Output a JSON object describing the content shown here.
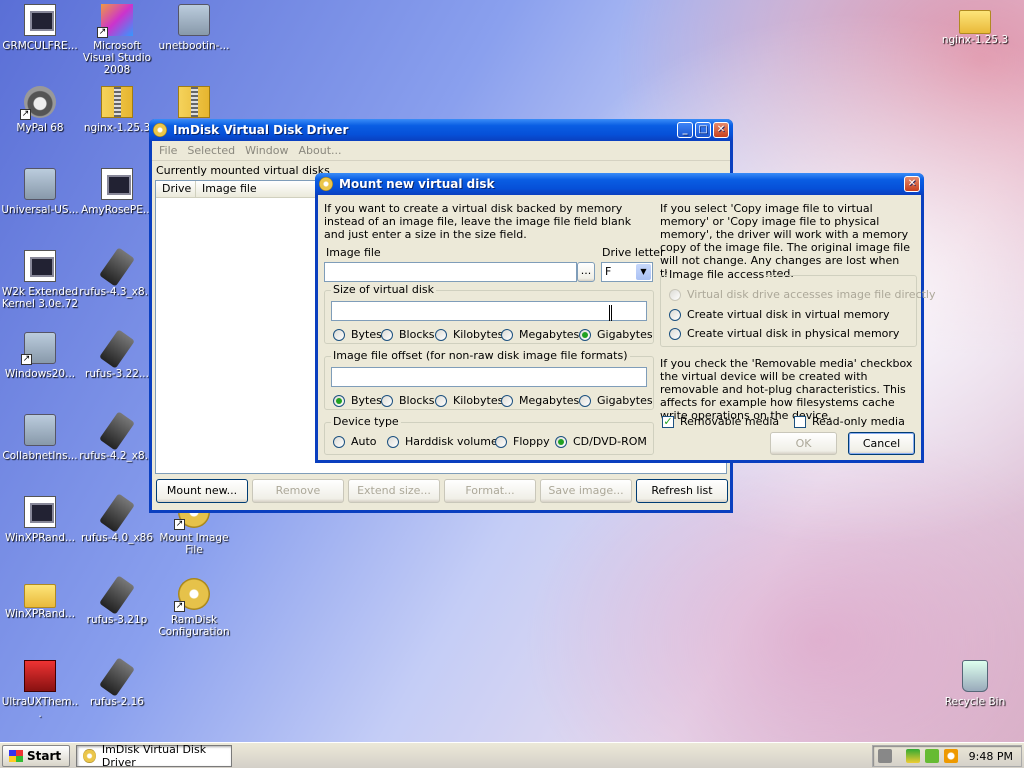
{
  "desktop": {
    "icons": [
      {
        "label": "GRMCULFRE..."
      },
      {
        "label": "Microsoft Visual Studio 2008"
      },
      {
        "label": "unetbootin-..."
      },
      {
        "label": "MyPal 68"
      },
      {
        "label": "nginx-1.25.3"
      },
      {
        "label": "nginx-1.25.3"
      },
      {
        "label": "Universal-US..."
      },
      {
        "label": "AmyRosePE..."
      },
      {
        "label": "W2k Extended Kernel 3.0e.72"
      },
      {
        "label": "rufus-4.3_x8..."
      },
      {
        "label": "Windows20..."
      },
      {
        "label": "rufus-3.22..."
      },
      {
        "label": "CollabnetIns..."
      },
      {
        "label": "rufus-4.2_x8..."
      },
      {
        "label": "WinXPRand..."
      },
      {
        "label": "rufus-4.0_x86"
      },
      {
        "label": "Mount Image File"
      },
      {
        "label": "WinXPRand..."
      },
      {
        "label": "rufus-3.21p"
      },
      {
        "label": "RamDisk Configuration"
      },
      {
        "label": "UltraUXThem..."
      },
      {
        "label": "rufus-2.16"
      },
      {
        "label": "Recycle Bin"
      }
    ]
  },
  "imdisk": {
    "title": "ImDisk Virtual Disk Driver",
    "menu": [
      "File",
      "Selected",
      "Window",
      "About..."
    ],
    "list_title": "Currently mounted virtual disks",
    "columns": [
      "Drive",
      "Image file"
    ],
    "buttons": {
      "mount": "Mount new...",
      "remove": "Remove",
      "extend": "Extend size...",
      "format": "Format...",
      "save": "Save image...",
      "refresh": "Refresh list"
    }
  },
  "dialog": {
    "title": "Mount new virtual disk",
    "intro": "If you want to create a virtual disk backed by memory instead of an image file, leave the image file field blank and just enter a size in the size field.",
    "image_file_label": "Image file",
    "image_file_value": "",
    "browse_label": "...",
    "drive_letter_label": "Drive letter",
    "drive_letter_value": "F",
    "size_group": "Size of virtual disk",
    "size_value": "",
    "size_units": [
      "Bytes",
      "Blocks",
      "Kilobytes",
      "Megabytes",
      "Gigabytes"
    ],
    "size_unit_selected": "Gigabytes",
    "offset_group": "Image file offset (for non-raw disk image file formats)",
    "offset_value": "",
    "offset_units": [
      "Bytes",
      "Blocks",
      "Kilobytes",
      "Megabytes",
      "Gigabytes"
    ],
    "offset_unit_selected": "Bytes",
    "device_group": "Device type",
    "device_types": [
      "Auto",
      "Harddisk volume",
      "Floppy",
      "CD/DVD-ROM"
    ],
    "device_selected": "CD/DVD-ROM",
    "copy_note": "If you select 'Copy image file to virtual memory' or 'Copy image file to physical memory', the driver will work with a memory copy of the image file. The original image file will not change. Any changes are lost when the drive is dismounted.",
    "access_group": "Image file access",
    "access_options": [
      "Virtual disk drive accesses image file directly",
      "Create virtual disk in virtual memory",
      "Create virtual disk in physical memory"
    ],
    "removable_note": "If you check the 'Removable media' checkbox the virtual device will be created with removable and hot-plug characteristics. This affects for example how filesystems cache write operations on the device.",
    "removable_label": "Removable media",
    "removable_checked": true,
    "readonly_label": "Read-only media",
    "readonly_checked": false,
    "ok_label": "OK",
    "cancel_label": "Cancel"
  },
  "taskbar": {
    "start_label": "Start",
    "task_label": "ImDisk Virtual Disk Driver",
    "clock": "9:48 PM"
  }
}
